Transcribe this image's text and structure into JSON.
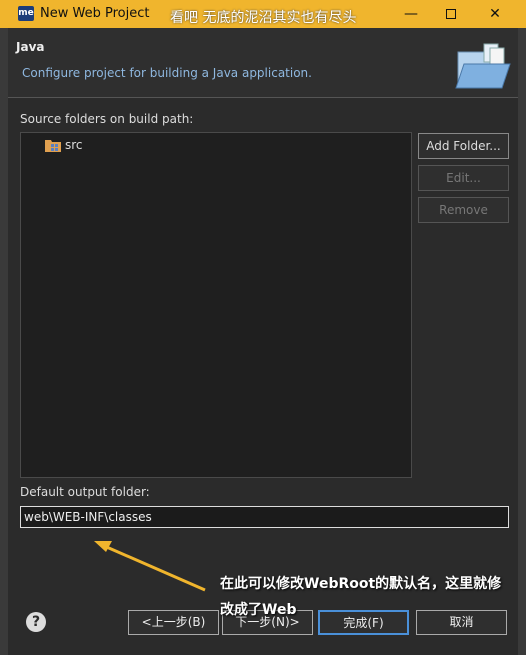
{
  "window": {
    "app_icon_text": "me",
    "title": "New Web Project",
    "overlay_caption": "看吧 无底的泥沼其实也有尽头",
    "minimize_glyph": "—",
    "close_glyph": "✕"
  },
  "header": {
    "title": "Java",
    "description": "Configure project for building a Java application."
  },
  "source": {
    "label": "Source folders on build path:",
    "items": [
      {
        "label": "src",
        "icon": "package-folder-icon"
      }
    ]
  },
  "buttons": {
    "add_folder": "Add Folder...",
    "edit": "Edit...",
    "remove": "Remove"
  },
  "output": {
    "label": "Default output folder:",
    "value": "web\\WEB-INF\\classes"
  },
  "footer": {
    "help": "?",
    "back": "<上一步(B)",
    "next": "下一步(N)>",
    "finish": "完成(F)",
    "cancel": "取消"
  },
  "annotation": {
    "text": "在此可以修改WebRoot的默认名，这里就修改成了Web",
    "color": "#f0b52d"
  }
}
